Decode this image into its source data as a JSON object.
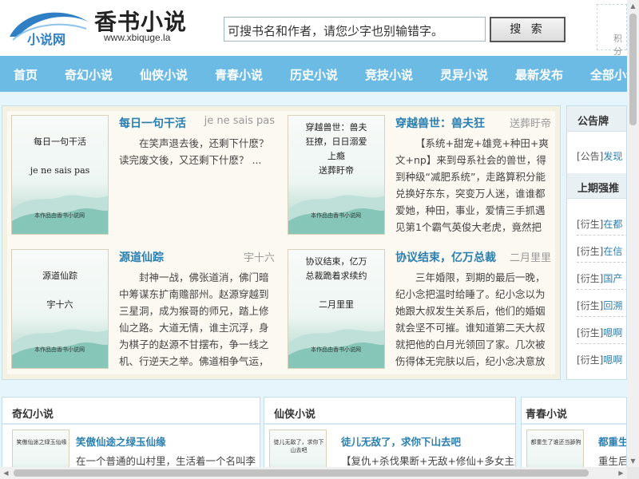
{
  "header": {
    "logo_text": "小说网",
    "site_title": "香书小说",
    "site_url": "www.xbiquge.la",
    "search_placeholder": "可搜书名和作者，请您少字也别输错字。",
    "search_button": "搜 索",
    "user_hint": "积分"
  },
  "nav": {
    "items": [
      {
        "label": "首页"
      },
      {
        "label": "奇幻小说"
      },
      {
        "label": "仙侠小说"
      },
      {
        "label": "青春小说"
      },
      {
        "label": "历史小说"
      },
      {
        "label": "竞技小说"
      },
      {
        "label": "灵异小说"
      },
      {
        "label": "最新发布"
      },
      {
        "label": "全部小说"
      }
    ]
  },
  "featured": [
    {
      "title": "每日一句干活",
      "author": "je ne sais pas",
      "cover_lines": [
        "每日一句干活",
        "",
        "je ne sais pas"
      ],
      "cover_footer": "本作品由香书小说网",
      "desc": "在笑声退去後，还剩下什麽？读完废文後，又还剩下什麽？ ..."
    },
    {
      "title": "穿越兽世：兽夫狂",
      "author": "送葬盱帝",
      "cover_lines": [
        "穿越兽世：兽夫",
        "狂撩，日日溺爱",
        "上瘾",
        "送葬盱帝"
      ],
      "cover_footer": "本作品由香书小说网",
      "desc": "【系统+甜宠+雄竞+种田+爽文+np】来到母系社会的兽世，得到种级“减肥系统”，走路算积分能兑换好东东，突变万人迷，谁谁都爱她，种田，事业，爱情三手抓遇见第1个霸气英俊大老虎，竟然把她给"
    },
    {
      "title": "源道仙踪",
      "author": "宇十六",
      "cover_lines": [
        "源道仙踪",
        "",
        "宇十六"
      ],
      "cover_footer": "本作品由香书小说网",
      "desc": "封神一战，佛张道消，佛门暗中筹谋东扩南赡部州。赵源穿越到三星洞，成为猴哥的师兄，踏上修仙之路。大道无情，谁主沉浮，身为棋子的赵源不甘摆布，争一线之机、行逆天之举。佛道相争气运，"
    },
    {
      "title": "协议结束，亿万总裁",
      "author": "二月里里",
      "cover_lines": [
        "协议结束，亿万",
        "总裁跪着求续约",
        "",
        "二月里里"
      ],
      "cover_footer": "本作品由香书小说网",
      "desc": "三年婚限，到期的最后一晚，纪小念把温时给睡了。纪小念以为她跟大叔发生关系后，他们的婚姻就会坚不可摧。谁知道第二天大叔就把他的白月光领回了家。几次被伤得体无完肤以后，纪小念决意放"
    }
  ],
  "sidebar": {
    "notice_title": "公告牌",
    "notice_item": {
      "tag": "[公告]",
      "text": "发现"
    },
    "rank_title": "上期强推",
    "rank_items": [
      {
        "tag": "[衍生]",
        "text": "在都"
      },
      {
        "tag": "[衍生]",
        "text": "在信"
      },
      {
        "tag": "[衍生]",
        "text": "国产"
      },
      {
        "tag": "[衍生]",
        "text": "回溯"
      },
      {
        "tag": "[衍生]",
        "text": "嗯啊"
      },
      {
        "tag": "[衍生]",
        "text": "嗯啊"
      }
    ]
  },
  "categories": [
    {
      "heading": "奇幻小说",
      "cover_text": "笑傲仙途之绿玉仙缘",
      "book_title": "笑傲仙途之绿玉仙缘",
      "book_desc": "在一个普通的山村里，生活着一个名叫李"
    },
    {
      "heading": "仙侠小说",
      "cover_text": "徒儿无敌了，求你下山去吧",
      "book_title": "徒儿无敌了，求你下山去吧",
      "book_desc": "【复仇+杀伐果断+无敌+修仙+多女主】"
    },
    {
      "heading": "青春小说",
      "cover_text": "都重生了谁还当舔狗",
      "book_title": "都重生",
      "book_desc": "重生后"
    }
  ]
}
